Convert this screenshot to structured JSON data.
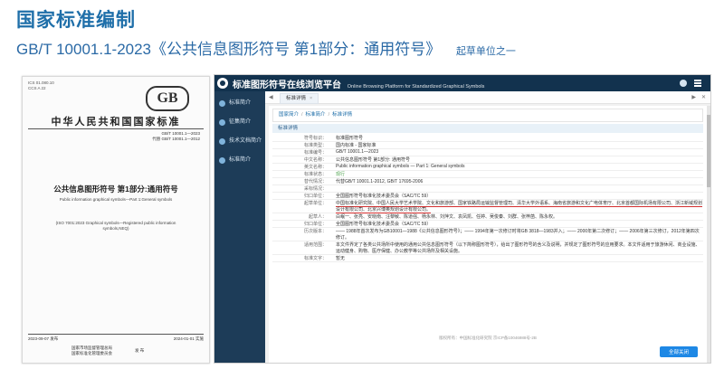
{
  "slide": {
    "title": "国家标准编制",
    "subtitle": "GB/T 10001.1-2023《公共信息图形符号 第1部分：通用符号》",
    "note": "起草单位之一"
  },
  "doc": {
    "ics": [
      "ICS 01.080.10",
      "CCS A 22"
    ],
    "logo": "GB",
    "national_title": "中华人民共和国国家标准",
    "number": "GB/T 10001.1—2023",
    "replaces": "代替 GB/T 10001.1—2012",
    "title": "公共信息图形符号 第1部分:通用符号",
    "subtitle_en": "Public information graphical symbols—Part 1:General symbols",
    "iso_note": "(ISO 7001:2023 Graphical symbols—Registered public information symbols,NEQ)",
    "release": "2023-09-07 发布",
    "implement": "2024-01-01 实施",
    "publisher": [
      "国家市场监督管理总局",
      "国家标准化管理委员会"
    ],
    "publisher_action": "发 布"
  },
  "app": {
    "title": "标准图形符号在线浏览平台",
    "title_en": "Online Browsing Platform for Standardized Graphical Symbols",
    "sidebar": [
      "标准简介",
      "征集简介",
      "技术文档简介",
      "标准简介"
    ],
    "tab": "标准详情",
    "breadcrumb": [
      "国家简介",
      "标准简介",
      "标准详情"
    ],
    "section": "标准详情",
    "rows": [
      {
        "k": "符号标识：",
        "v": "标准图形符号"
      },
      {
        "k": "标准类型：",
        "v": "国内标准 - 国家标准"
      },
      {
        "k": "标准编号：",
        "v": "GB/T 10001.1—2023"
      },
      {
        "k": "中文名称：",
        "v": "公共信息图形符号 第1部分: 通用符号"
      },
      {
        "k": "英文名称：",
        "v": "Public information graphical symbols — Part 1: General symbols"
      },
      {
        "k": "标准状态：",
        "v": "现行"
      },
      {
        "k": "替代情况：",
        "v": "代替GB/T 10001.1-2012, GB/T 17695-2006"
      },
      {
        "k": "采标情况：",
        "v": ""
      },
      {
        "k": "归口单位：",
        "v": "全国图形符号标准化技术委员会（SAC/TC 59）"
      },
      {
        "k": "起草单位：",
        "v": "中国标准化研究院、中国人民大学艺术学院、文化和旅游部、国家铁路局运输监督管理司、清华大学外语系、海南省旅游和文化广电体育厅、北京首都国际机场有限公司、浙江新域规划设计有限公司、北京兴博奥规划设计有限公司。"
      },
      {
        "k": "起草人：",
        "v": "白岷一、张亮、安晓南、汪黎敏、陈道强、杨永林、刘萍文、袁凤凯、任婷、吴俊秦、刘群、张梓菡、陈永权。"
      },
      {
        "k": "归口单位：",
        "v": "全国图形符号标准化技术委员会（SAC/TC 59）"
      },
      {
        "k": "历次版本：",
        "v": "—— 1988年首次发布为GB10001—1988《公共信息图形符号》；—— 1994年第一次修订时将GB 3818—1983并入；—— 2000年第二次修订；—— 2006年第三次修订，2012年第四次修订。"
      },
      {
        "k": "适用范围：",
        "v": "本文件界定了各类公共场所中使用的通用公共信息图形符号（以下简称图形符号），给出了图形符号的含义及说明，并规定了图形符号的应用要求。本文件适用于旅游休闲、商业设施、运动健身、购物、医疗保健、办公教学等公共场所及相关设施。"
      },
      {
        "k": "标准文字：",
        "v": "暂无"
      }
    ],
    "footer": "版权所有：中国标准化研究院  京ICP备10046988号-2B",
    "button": "全部关闭"
  }
}
